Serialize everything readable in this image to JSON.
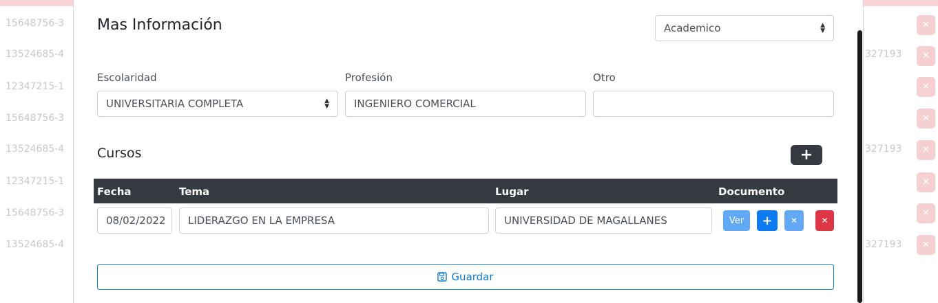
{
  "background": {
    "ruts": [
      "15648756-3",
      "13524685-4",
      "12347215-1",
      "15648756-3",
      "13524685-4",
      "12347215-1",
      "15648756-3",
      "13524685-4"
    ],
    "phone_partial": "327193"
  },
  "modal": {
    "title": "Mas Información",
    "category_select": {
      "value": "Academico"
    },
    "fields": {
      "escolaridad": {
        "label": "Escolaridad",
        "value": "UNIVERSITARIA COMPLETA"
      },
      "profesion": {
        "label": "Profesión",
        "value": "INGENIERO COMERCIAL"
      },
      "otro": {
        "label": "Otro",
        "value": ""
      }
    },
    "cursos": {
      "title": "Cursos",
      "add_icon": "plus-icon",
      "columns": [
        "Fecha",
        "Tema",
        "Lugar",
        "Documento"
      ],
      "rows": [
        {
          "fecha": "08/02/2022",
          "tema": "LIDERAZGO EN LA EMPRESA",
          "lugar": "UNIVERSIDAD DE MAGALLANES",
          "ver_label": "Ver"
        }
      ]
    },
    "save_label": "Guardar",
    "save_icon": "floppy-disk-icon"
  },
  "colors": {
    "primary": "#0d7bf0",
    "danger": "#dc3545",
    "dark": "#343a40",
    "info_light": "#61a9f4"
  }
}
